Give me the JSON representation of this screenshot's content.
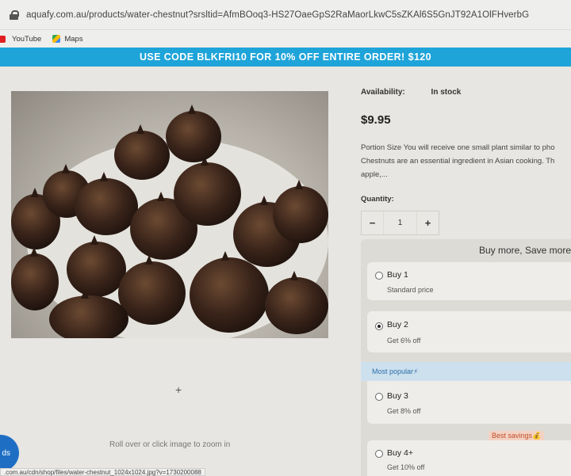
{
  "browser": {
    "url": "aquafy.com.au/products/water-chestnut?srsltid=AfmBOoq3-HS27OaeGpS2RaMaorLkwC5sZKAl6S5GnJT92A1OlFHverbG",
    "bookmarks": [
      {
        "label": "YouTube",
        "icon": "youtube-icon"
      },
      {
        "label": "Maps",
        "icon": "maps-icon"
      }
    ],
    "status_url": ".com.au/cdn/shop/files/water-chestnut_1024x1024.jpg?v=1730200088"
  },
  "promo": {
    "text": "USE CODE BLKFRI10 FOR 10% OFF ENTIRE ORDER!",
    "amount": "$120",
    "color": "#1ea4d9"
  },
  "gallery": {
    "zoom_hint": "Roll over or click image to zoom in",
    "chat_label": "ds"
  },
  "product": {
    "availability_label": "Availability:",
    "availability_value": "In stock",
    "price": "$9.95",
    "description_lines": [
      "Portion Size You will receive one small plant similar to pho",
      "Chestnuts are an essential ingredient in Asian cooking. Th",
      "apple,..."
    ],
    "quantity_label": "Quantity:",
    "quantity": "1",
    "minus": "−",
    "plus": "+"
  },
  "bundle": {
    "title": "Buy more, Save more",
    "options": [
      {
        "title": "Buy 1",
        "subtitle": "Standard price",
        "selected": false
      },
      {
        "title": "Buy 2",
        "subtitle": "Get 6% off",
        "selected": true
      },
      {
        "title": "Buy 3",
        "subtitle": "Get 8% off",
        "selected": false
      },
      {
        "title": "Buy 4+",
        "subtitle": "Get 10% off",
        "selected": false
      }
    ],
    "popular_badge": "Most popular⚡",
    "savings_badge": "Best savings💰"
  }
}
